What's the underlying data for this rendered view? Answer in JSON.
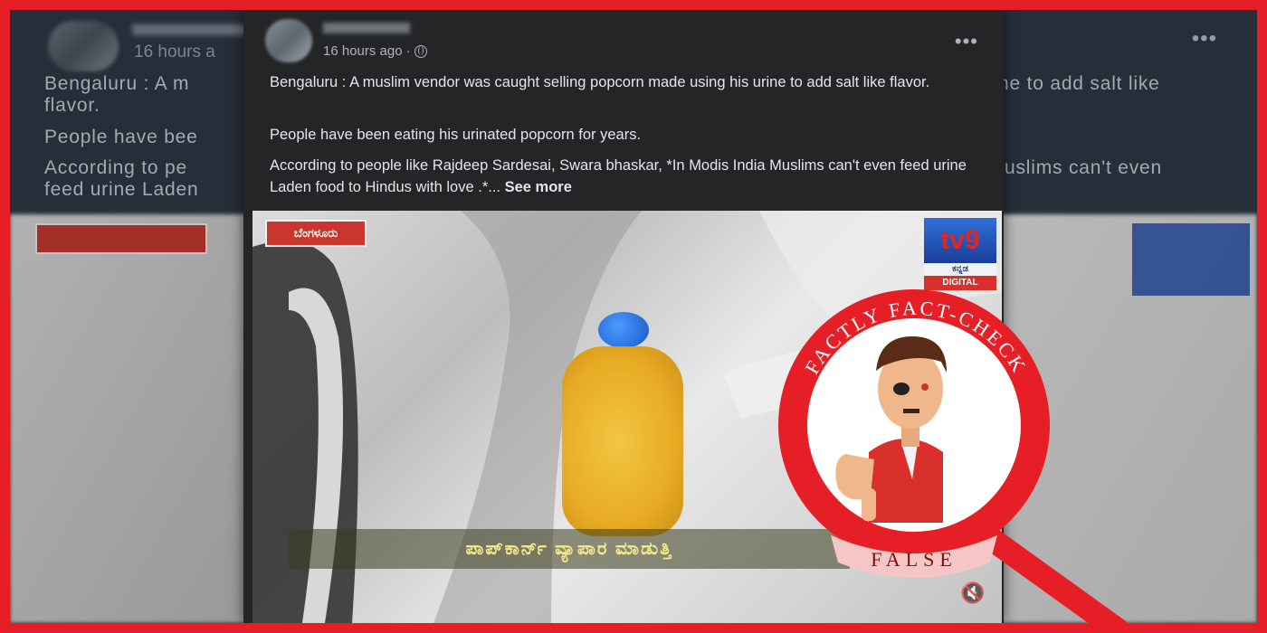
{
  "post": {
    "time": "16 hours ago",
    "privacy_icon": "globe-icon",
    "more_icon": "more-dots-icon",
    "paragraphs": [
      "Bengaluru : A muslim vendor was caught selling popcorn made using his urine to add salt like flavor.",
      "People have been eating his urinated popcorn for years.",
      "According to people like Rajdeep Sardesai, Swara bhaskar, *In Modis India Muslims can't even feed urine Laden food to Hindus with love .*..."
    ],
    "see_more": "See more"
  },
  "background": {
    "time": "16 hours a",
    "line1_left": "Bengaluru : A m",
    "line1_right": "ne to add salt like",
    "line2": "flavor.",
    "line3": "People have bee",
    "line4_left": "According to pe",
    "line4_right": "uslims can't even",
    "line5": "feed urine Laden"
  },
  "video": {
    "tv9_label": "tv9",
    "tv9_digital": "DIGITAL",
    "mute_icon": "mute-icon"
  },
  "stamp": {
    "arc_text": "FACTLY FACT-CHECK",
    "verdict": "FALSE",
    "accent": "#e61f26",
    "icon": "thumbs-down-character-icon"
  },
  "colors": {
    "border": "#e61f26",
    "post_bg": "#242526",
    "text": "#e4e6eb",
    "muted": "#b0b3b8"
  }
}
